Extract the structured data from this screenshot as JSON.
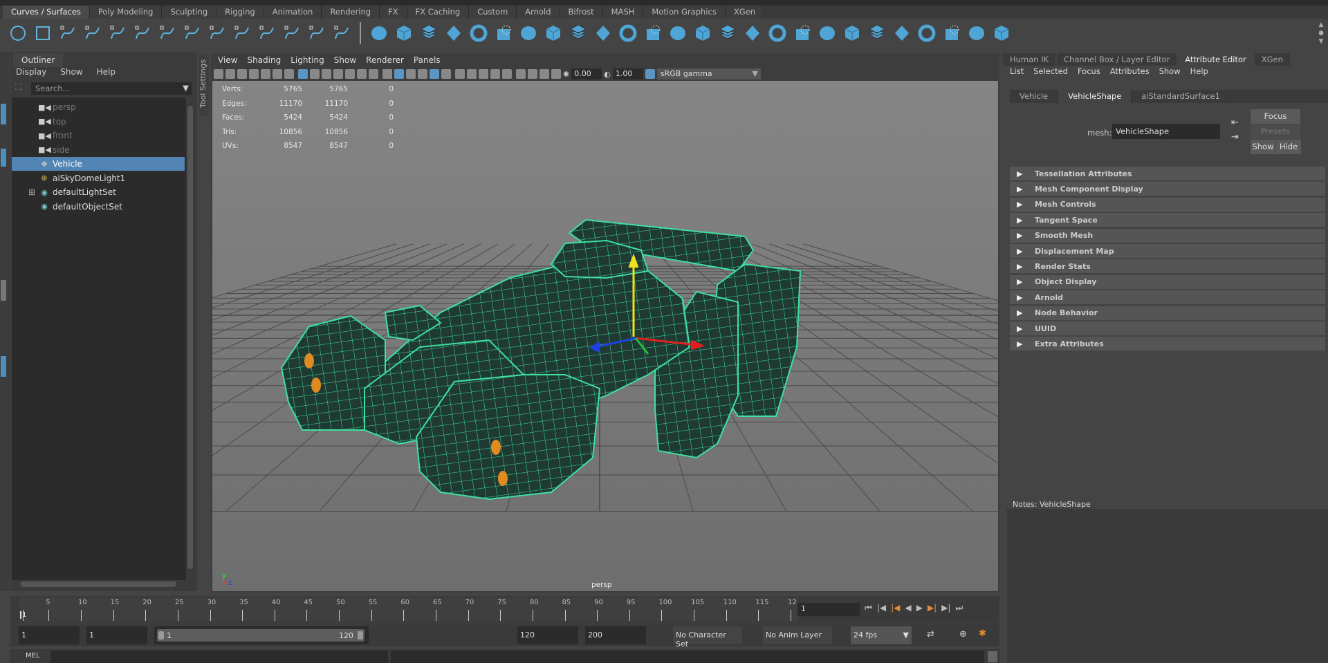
{
  "shelf_tabs": [
    "Curves / Surfaces",
    "Poly Modeling",
    "Sculpting",
    "Rigging",
    "Animation",
    "Rendering",
    "FX",
    "FX Caching",
    "Custom",
    "Arnold",
    "Bifrost",
    "MASH",
    "Motion Graphics",
    "XGen"
  ],
  "shelf_active": 0,
  "shelf_icons_curves": [
    "nurbs-circle",
    "nurbs-square",
    "ep-curve",
    "pencil-curve",
    "cv-curve",
    "bezier-curve",
    "cut-curve",
    "curve-tool",
    "attach-curve",
    "arc-tool",
    "rebuild-curve",
    "insert-knot",
    "fillet-curve",
    "open-close-curve"
  ],
  "shelf_icons_surfaces": [
    "nurbs-sphere",
    "nurbs-cube",
    "nurbs-cylinder",
    "nurbs-cone",
    "nurbs-plane",
    "nurbs-torus",
    "revolve",
    "loft",
    "planar",
    "extrude",
    "birail",
    "boundary",
    "square-surface",
    "bevel",
    "trim",
    "untrim",
    "project-curve",
    "intersect",
    "stitch",
    "fillet",
    "offset",
    "detach",
    "rebuild",
    "split",
    "sculpt",
    "duplicate-surface"
  ],
  "outliner": {
    "title": "Outliner",
    "menu": [
      "Display",
      "Show",
      "Help"
    ],
    "search_placeholder": "Search...",
    "items": [
      {
        "label": "persp",
        "icon": "camera",
        "dim": true
      },
      {
        "label": "top",
        "icon": "camera",
        "dim": true
      },
      {
        "label": "front",
        "icon": "camera",
        "dim": true
      },
      {
        "label": "side",
        "icon": "camera",
        "dim": true
      },
      {
        "label": "Vehicle",
        "icon": "mesh-transform",
        "selected": true
      },
      {
        "label": "aiSkyDomeLight1",
        "icon": "skydome"
      },
      {
        "label": "defaultLightSet",
        "icon": "set",
        "expandable": true
      },
      {
        "label": "defaultObjectSet",
        "icon": "set"
      }
    ]
  },
  "tool_settings_label": "Tool Settings",
  "viewport": {
    "menu": [
      "View",
      "Shading",
      "Lighting",
      "Show",
      "Renderer",
      "Panels"
    ],
    "exposure": "0.00",
    "gamma": "1.00",
    "color_management": "sRGB gamma",
    "camera": "persp",
    "hud": [
      {
        "label": "Verts:",
        "a": "5765",
        "b": "5765",
        "c": "0"
      },
      {
        "label": "Edges:",
        "a": "11170",
        "b": "11170",
        "c": "0"
      },
      {
        "label": "Faces:",
        "a": "5424",
        "b": "5424",
        "c": "0"
      },
      {
        "label": "Tris:",
        "a": "10856",
        "b": "10856",
        "c": "0"
      },
      {
        "label": "UVs:",
        "a": "8547",
        "b": "8547",
        "c": "0"
      }
    ],
    "wire_color": "#3fe0a0",
    "bg_color": "#7b7b7b"
  },
  "right_panel": {
    "tabs": [
      "Human IK",
      "Channel Box / Layer Editor",
      "Attribute Editor",
      "XGen"
    ],
    "active_tab": 2,
    "menu": [
      "List",
      "Selected",
      "Focus",
      "Attributes",
      "Show",
      "Help"
    ],
    "node_tabs": [
      "Vehicle",
      "VehicleShape",
      "aiStandardSurface1"
    ],
    "active_node_tab": 1,
    "mesh_label": "mesh:",
    "mesh_value": "VehicleShape",
    "focus": "Focus",
    "presets": "Presets",
    "show": "Show",
    "hide": "Hide",
    "sections": [
      "Tessellation Attributes",
      "Mesh Component Display",
      "Mesh Controls",
      "Tangent Space",
      "Smooth Mesh",
      "Displacement Map",
      "Render Stats",
      "Object Display",
      "Arnold",
      "Node Behavior",
      "UUID",
      "Extra Attributes"
    ],
    "notes_label": "Notes:  VehicleShape"
  },
  "timeline": {
    "ticks": [
      "5",
      "10",
      "15",
      "20",
      "25",
      "30",
      "35",
      "40",
      "45",
      "50",
      "55",
      "60",
      "65",
      "70",
      "75",
      "80",
      "85",
      "90",
      "95",
      "100",
      "105",
      "110",
      "115",
      "12"
    ],
    "current_frame": "1",
    "start_marker": "1"
  },
  "range": {
    "start": "1",
    "playback_start": "1",
    "slider_start": "1",
    "slider_end": "120",
    "playback_end": "120",
    "end": "200",
    "character_set": "No Character Set",
    "anim_layer": "No Anim Layer",
    "fps": "24 fps"
  },
  "mel_label": "MEL"
}
